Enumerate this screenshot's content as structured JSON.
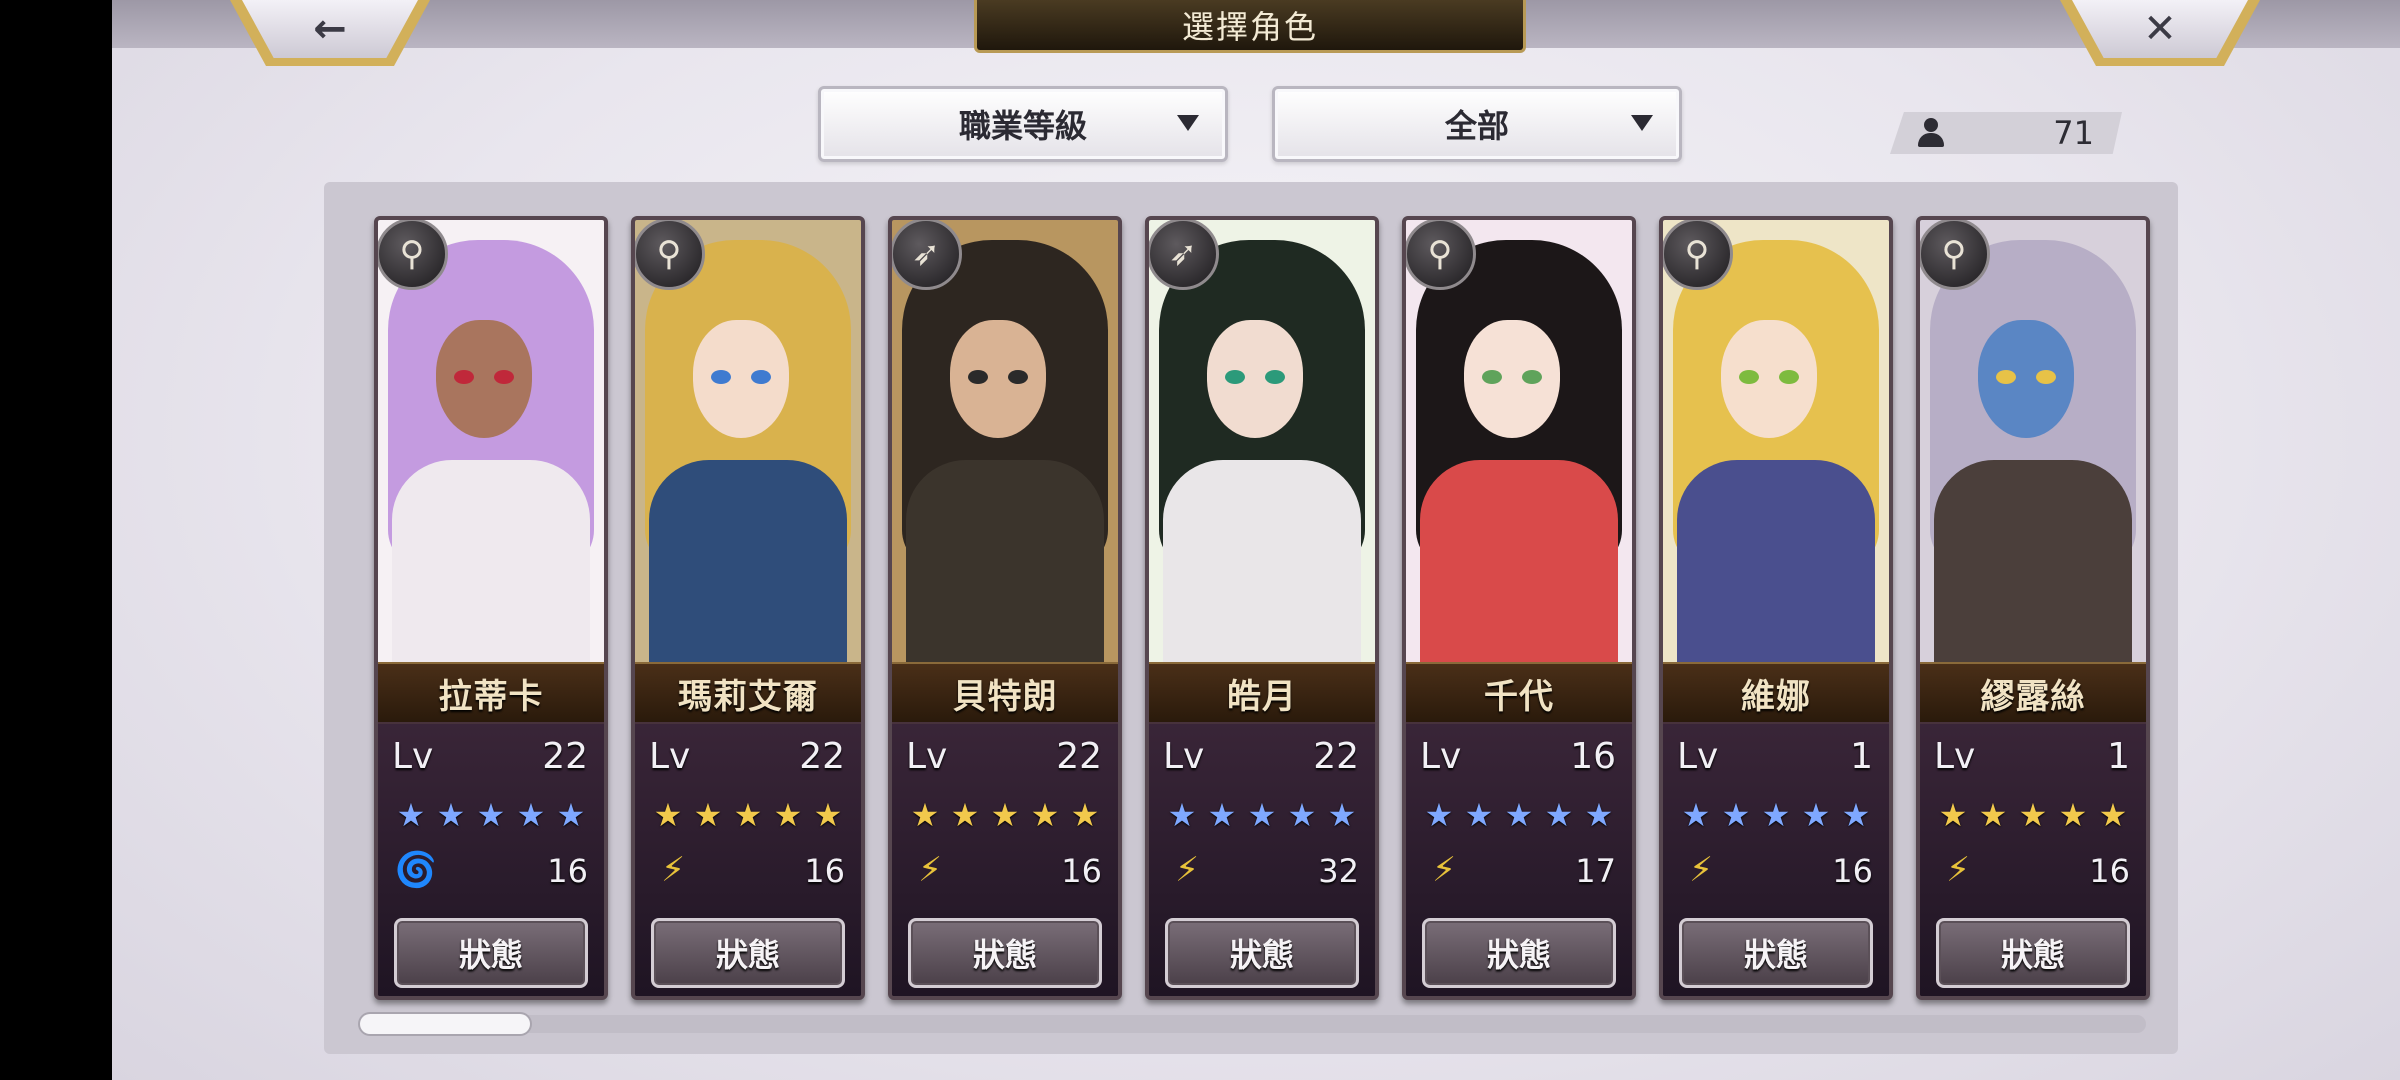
{
  "header": {
    "title": "選擇角色",
    "back_icon": "←",
    "close_icon": "✕"
  },
  "filters": {
    "sort_label": "職業等級",
    "filter_label": "全部"
  },
  "roster": {
    "count": "71"
  },
  "colors": {
    "blue_star": "#7fa8ff",
    "gold_star": "#f2c94c",
    "wind_icon": "#e8c23a",
    "water_icon": "#6fa8ff"
  },
  "status_label": "狀態",
  "level_label": "Lv",
  "characters": [
    {
      "name": "拉蒂卡",
      "level": "22",
      "stars": "★★★★★",
      "star_color": "blue",
      "attr": "wind-vortex-icon",
      "attr_glyph": "🌀",
      "attr_value": "16",
      "class_glyph": "⚲"
    },
    {
      "name": "瑪莉艾爾",
      "level": "22",
      "stars": "★★★★★",
      "star_color": "gold",
      "attr": "feather-icon",
      "attr_glyph": "⚡",
      "attr_value": "16",
      "class_glyph": "⚲"
    },
    {
      "name": "貝特朗",
      "level": "22",
      "stars": "★★★★★",
      "star_color": "gold",
      "attr": "feather-icon",
      "attr_glyph": "⚡",
      "attr_value": "16",
      "class_glyph": "➶"
    },
    {
      "name": "皓月",
      "level": "22",
      "stars": "★★★★★",
      "star_color": "blue",
      "attr": "feather-icon",
      "attr_glyph": "⚡",
      "attr_value": "32",
      "class_glyph": "➶"
    },
    {
      "name": "千代",
      "level": "16",
      "stars": "★★★★★",
      "star_color": "blue",
      "attr": "feather-icon",
      "attr_glyph": "⚡",
      "attr_value": "17",
      "class_glyph": "⚲"
    },
    {
      "name": "維娜",
      "level": "1",
      "stars": "★★★★★",
      "star_color": "blue",
      "attr": "feather-icon",
      "attr_glyph": "⚡",
      "attr_value": "16",
      "class_glyph": "⚲"
    },
    {
      "name": "繆露絲",
      "level": "1",
      "stars": "★★★★★",
      "star_color": "gold",
      "attr": "feather-icon",
      "attr_glyph": "⚡",
      "attr_value": "16",
      "class_glyph": "⚲"
    }
  ]
}
